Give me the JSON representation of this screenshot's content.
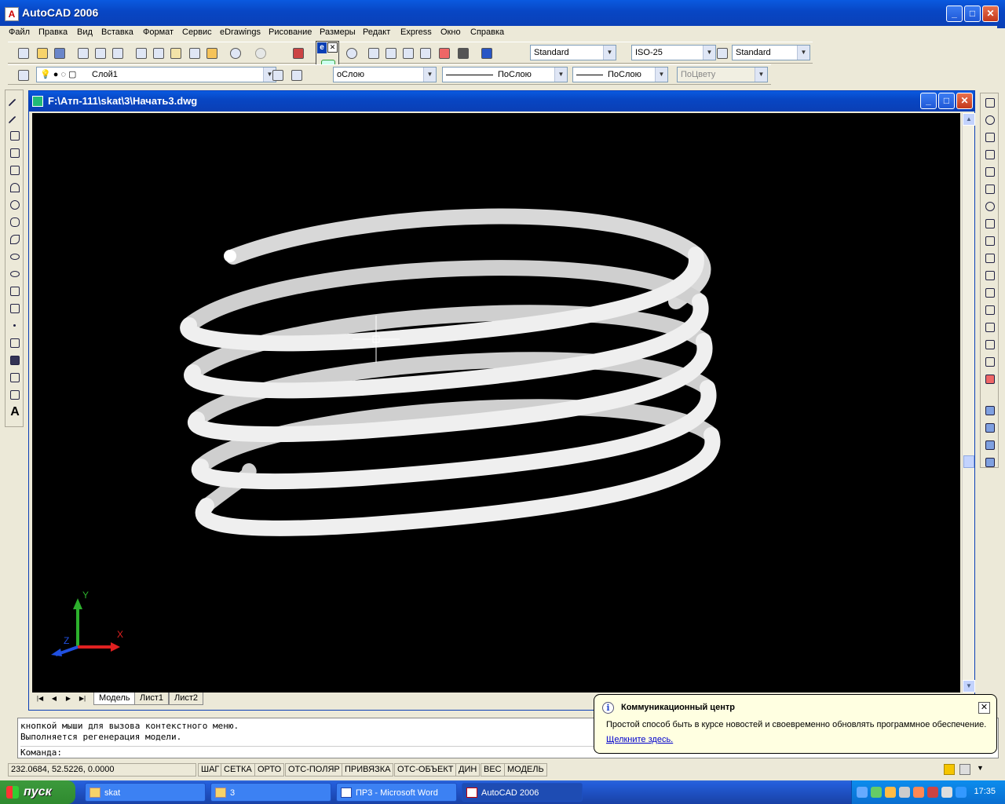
{
  "app": {
    "title": "AutoCAD 2006"
  },
  "menu": [
    "Файл",
    "Правка",
    "Вид",
    "Вставка",
    "Формат",
    "Сервис",
    "eDrawings",
    "Рисование",
    "Размеры",
    "Редакт",
    "Express",
    "Окно",
    "Справка"
  ],
  "toolbar": {
    "text_style": "Standard",
    "dim_style": "ISO-25",
    "table_style": "Standard",
    "layer": "Слой1",
    "color": "оСлою",
    "linetype": "ПоСлою",
    "lineweight": "ПоСлою",
    "plotstyle": "ПоЦвету"
  },
  "document": {
    "title": "F:\\Атп-111\\skat\\3\\Начать3.dwg",
    "tabs": [
      "Модель",
      "Лист1",
      "Лист2"
    ],
    "active_tab": "Модель"
  },
  "ucs": {
    "x_label": "X",
    "y_label": "Y",
    "z_label": "Z"
  },
  "command": {
    "lines": [
      "кнопкой мыши для вызова контекстного меню.",
      "Выполняется регенерация модели."
    ],
    "prompt": "Команда:"
  },
  "status": {
    "coords": "232.0684, 52.5226, 0.0000",
    "buttons": [
      "ШАГ",
      "СЕТКА",
      "ОРТО",
      "ОТС-ПОЛЯР",
      "ПРИВЯЗКА",
      "ОТС-ОБЪЕКТ",
      "ДИН",
      "ВЕС",
      "МОДЕЛЬ"
    ]
  },
  "balloon": {
    "title": "Коммуникационный центр",
    "text": "Простой способ быть в курсе новостей и своевременно обновлять программное обеспечение.",
    "link": "Щелкните здесь."
  },
  "taskbar": {
    "start": "пуск",
    "tasks": [
      "skat",
      "3",
      "ПР3 - Microsoft Word",
      "AutoCAD 2006"
    ],
    "active_task": "AutoCAD 2006",
    "clock": "17:35"
  },
  "floating_toolbar": {
    "label": "e"
  },
  "colors": {
    "xp_blue": "#0a3fb5",
    "viewport_bg": "#000000",
    "spring": "#e8e8e8"
  }
}
